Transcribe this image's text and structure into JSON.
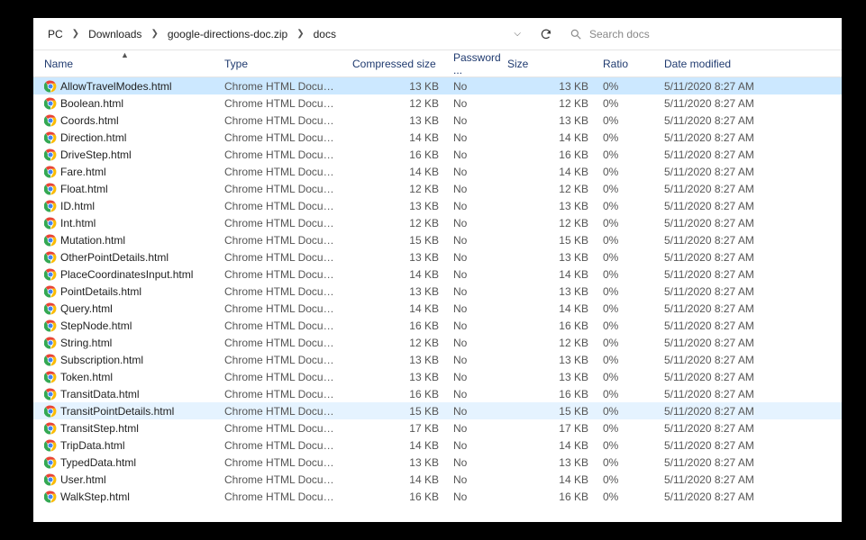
{
  "nav": {
    "breadcrumb": [
      "PC",
      "Downloads",
      "google-directions-doc.zip",
      "docs"
    ],
    "search_placeholder": "Search docs"
  },
  "columns": {
    "name": "Name",
    "type": "Type",
    "compressed_size": "Compressed size",
    "password": "Password ...",
    "size": "Size",
    "ratio": "Ratio",
    "date_modified": "Date modified",
    "sort_column": "name",
    "sort_direction": "asc"
  },
  "files": [
    {
      "name": "AllowTravelModes.html",
      "type": "Chrome HTML Document",
      "csize": "13 KB",
      "pwd": "No",
      "size": "13 KB",
      "ratio": "0%",
      "date": "5/11/2020 8:27 AM",
      "state": "selected"
    },
    {
      "name": "Boolean.html",
      "type": "Chrome HTML Document",
      "csize": "12 KB",
      "pwd": "No",
      "size": "12 KB",
      "ratio": "0%",
      "date": "5/11/2020 8:27 AM",
      "state": ""
    },
    {
      "name": "Coords.html",
      "type": "Chrome HTML Document",
      "csize": "13 KB",
      "pwd": "No",
      "size": "13 KB",
      "ratio": "0%",
      "date": "5/11/2020 8:27 AM",
      "state": ""
    },
    {
      "name": "Direction.html",
      "type": "Chrome HTML Document",
      "csize": "14 KB",
      "pwd": "No",
      "size": "14 KB",
      "ratio": "0%",
      "date": "5/11/2020 8:27 AM",
      "state": ""
    },
    {
      "name": "DriveStep.html",
      "type": "Chrome HTML Document",
      "csize": "16 KB",
      "pwd": "No",
      "size": "16 KB",
      "ratio": "0%",
      "date": "5/11/2020 8:27 AM",
      "state": ""
    },
    {
      "name": "Fare.html",
      "type": "Chrome HTML Document",
      "csize": "14 KB",
      "pwd": "No",
      "size": "14 KB",
      "ratio": "0%",
      "date": "5/11/2020 8:27 AM",
      "state": ""
    },
    {
      "name": "Float.html",
      "type": "Chrome HTML Document",
      "csize": "12 KB",
      "pwd": "No",
      "size": "12 KB",
      "ratio": "0%",
      "date": "5/11/2020 8:27 AM",
      "state": ""
    },
    {
      "name": "ID.html",
      "type": "Chrome HTML Document",
      "csize": "13 KB",
      "pwd": "No",
      "size": "13 KB",
      "ratio": "0%",
      "date": "5/11/2020 8:27 AM",
      "state": ""
    },
    {
      "name": "Int.html",
      "type": "Chrome HTML Document",
      "csize": "12 KB",
      "pwd": "No",
      "size": "12 KB",
      "ratio": "0%",
      "date": "5/11/2020 8:27 AM",
      "state": ""
    },
    {
      "name": "Mutation.html",
      "type": "Chrome HTML Document",
      "csize": "15 KB",
      "pwd": "No",
      "size": "15 KB",
      "ratio": "0%",
      "date": "5/11/2020 8:27 AM",
      "state": ""
    },
    {
      "name": "OtherPointDetails.html",
      "type": "Chrome HTML Document",
      "csize": "13 KB",
      "pwd": "No",
      "size": "13 KB",
      "ratio": "0%",
      "date": "5/11/2020 8:27 AM",
      "state": ""
    },
    {
      "name": "PlaceCoordinatesInput.html",
      "type": "Chrome HTML Document",
      "csize": "14 KB",
      "pwd": "No",
      "size": "14 KB",
      "ratio": "0%",
      "date": "5/11/2020 8:27 AM",
      "state": ""
    },
    {
      "name": "PointDetails.html",
      "type": "Chrome HTML Document",
      "csize": "13 KB",
      "pwd": "No",
      "size": "13 KB",
      "ratio": "0%",
      "date": "5/11/2020 8:27 AM",
      "state": ""
    },
    {
      "name": "Query.html",
      "type": "Chrome HTML Document",
      "csize": "14 KB",
      "pwd": "No",
      "size": "14 KB",
      "ratio": "0%",
      "date": "5/11/2020 8:27 AM",
      "state": ""
    },
    {
      "name": "StepNode.html",
      "type": "Chrome HTML Document",
      "csize": "16 KB",
      "pwd": "No",
      "size": "16 KB",
      "ratio": "0%",
      "date": "5/11/2020 8:27 AM",
      "state": ""
    },
    {
      "name": "String.html",
      "type": "Chrome HTML Document",
      "csize": "12 KB",
      "pwd": "No",
      "size": "12 KB",
      "ratio": "0%",
      "date": "5/11/2020 8:27 AM",
      "state": ""
    },
    {
      "name": "Subscription.html",
      "type": "Chrome HTML Document",
      "csize": "13 KB",
      "pwd": "No",
      "size": "13 KB",
      "ratio": "0%",
      "date": "5/11/2020 8:27 AM",
      "state": ""
    },
    {
      "name": "Token.html",
      "type": "Chrome HTML Document",
      "csize": "13 KB",
      "pwd": "No",
      "size": "13 KB",
      "ratio": "0%",
      "date": "5/11/2020 8:27 AM",
      "state": ""
    },
    {
      "name": "TransitData.html",
      "type": "Chrome HTML Document",
      "csize": "16 KB",
      "pwd": "No",
      "size": "16 KB",
      "ratio": "0%",
      "date": "5/11/2020 8:27 AM",
      "state": ""
    },
    {
      "name": "TransitPointDetails.html",
      "type": "Chrome HTML Document",
      "csize": "15 KB",
      "pwd": "No",
      "size": "15 KB",
      "ratio": "0%",
      "date": "5/11/2020 8:27 AM",
      "state": "hover"
    },
    {
      "name": "TransitStep.html",
      "type": "Chrome HTML Document",
      "csize": "17 KB",
      "pwd": "No",
      "size": "17 KB",
      "ratio": "0%",
      "date": "5/11/2020 8:27 AM",
      "state": ""
    },
    {
      "name": "TripData.html",
      "type": "Chrome HTML Document",
      "csize": "14 KB",
      "pwd": "No",
      "size": "14 KB",
      "ratio": "0%",
      "date": "5/11/2020 8:27 AM",
      "state": ""
    },
    {
      "name": "TypedData.html",
      "type": "Chrome HTML Document",
      "csize": "13 KB",
      "pwd": "No",
      "size": "13 KB",
      "ratio": "0%",
      "date": "5/11/2020 8:27 AM",
      "state": ""
    },
    {
      "name": "User.html",
      "type": "Chrome HTML Document",
      "csize": "14 KB",
      "pwd": "No",
      "size": "14 KB",
      "ratio": "0%",
      "date": "5/11/2020 8:27 AM",
      "state": ""
    },
    {
      "name": "WalkStep.html",
      "type": "Chrome HTML Document",
      "csize": "16 KB",
      "pwd": "No",
      "size": "16 KB",
      "ratio": "0%",
      "date": "5/11/2020 8:27 AM",
      "state": ""
    }
  ]
}
